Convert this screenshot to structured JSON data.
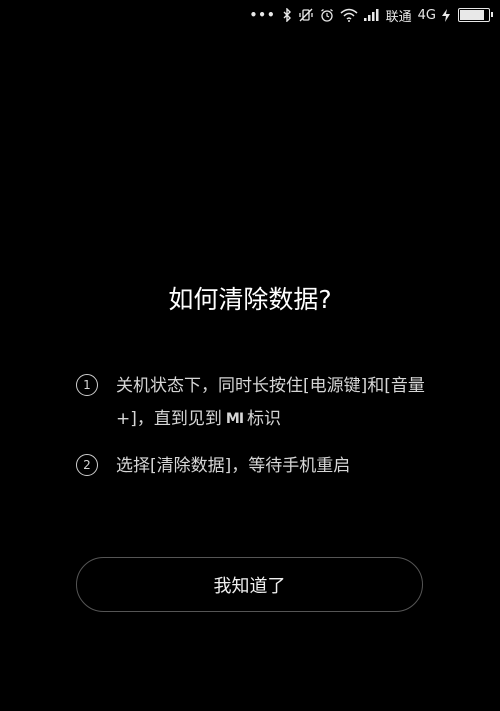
{
  "status_bar": {
    "carrier": "联通",
    "network": "4G",
    "battery_level": 0.85
  },
  "dialog": {
    "title": "如何清除数据?",
    "steps": [
      {
        "number": "1",
        "text_before_logo": "关机状态下，同时长按住[电源键]和[音量+]，直到见到",
        "logo": "MI",
        "text_after_logo": "标识"
      },
      {
        "number": "2",
        "text": "选择[清除数据]，等待手机重启"
      }
    ],
    "confirm_button_label": "我知道了"
  }
}
